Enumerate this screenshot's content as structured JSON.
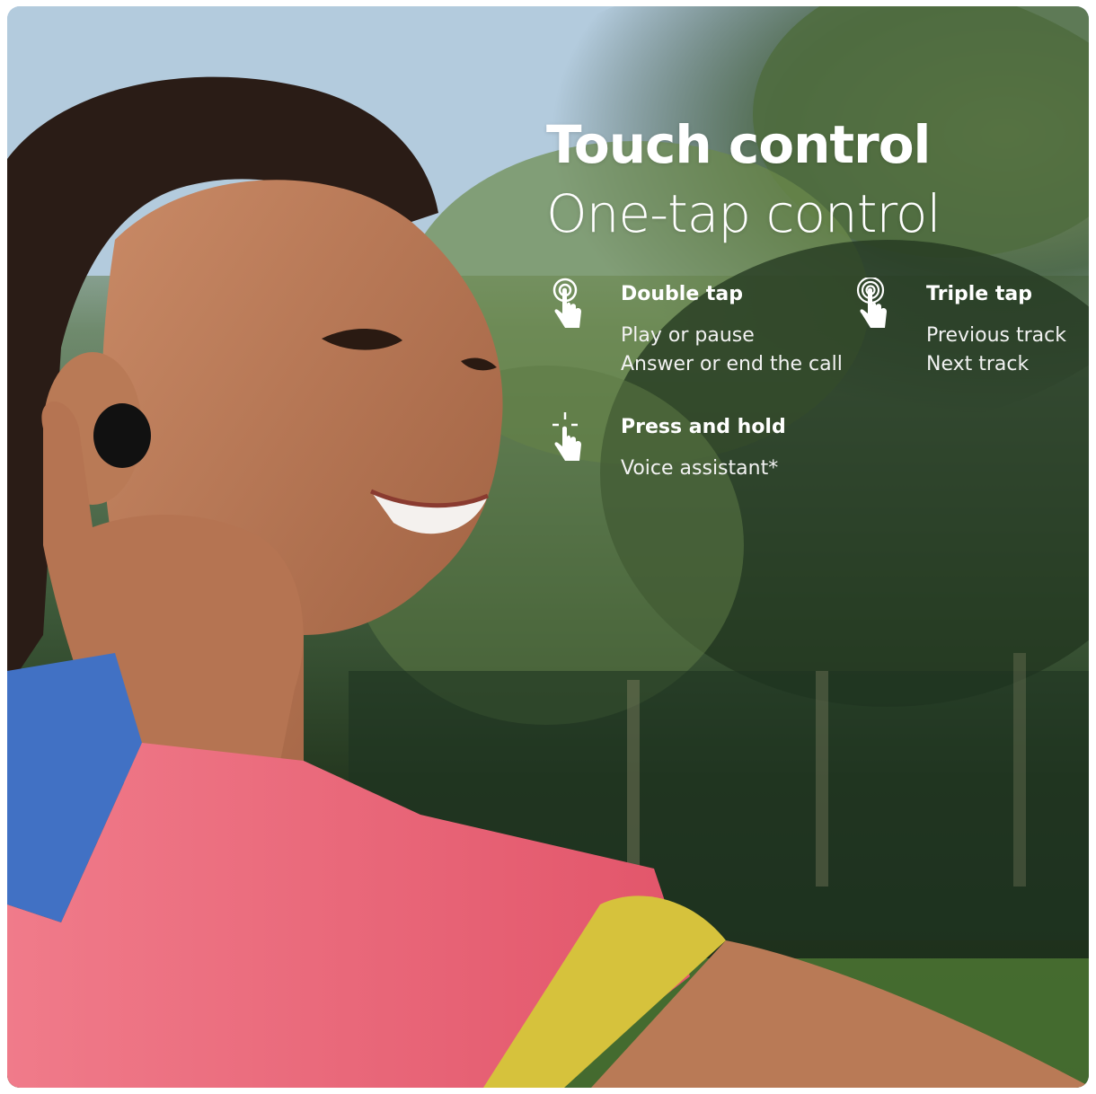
{
  "headline": {
    "title": "Touch control",
    "subtitle": "One-tap control"
  },
  "features": [
    {
      "name": "Double tap",
      "lines": [
        "Play or pause",
        "Answer or end the call"
      ],
      "icon": "double-tap-icon"
    },
    {
      "name": "Triple tap",
      "lines": [
        "Previous track",
        "Next track"
      ],
      "icon": "triple-tap-icon"
    },
    {
      "name": "Press and hold",
      "lines": [
        "Voice assistant*"
      ],
      "icon": "press-hold-icon"
    }
  ],
  "colors": {
    "text": "#ffffff",
    "sky": "#a9c3d9",
    "foliage": "#3e5a3a",
    "shirt": "#e86a7a",
    "collar": "#3f6fc0",
    "sleeve_band": "#d9c43a"
  }
}
